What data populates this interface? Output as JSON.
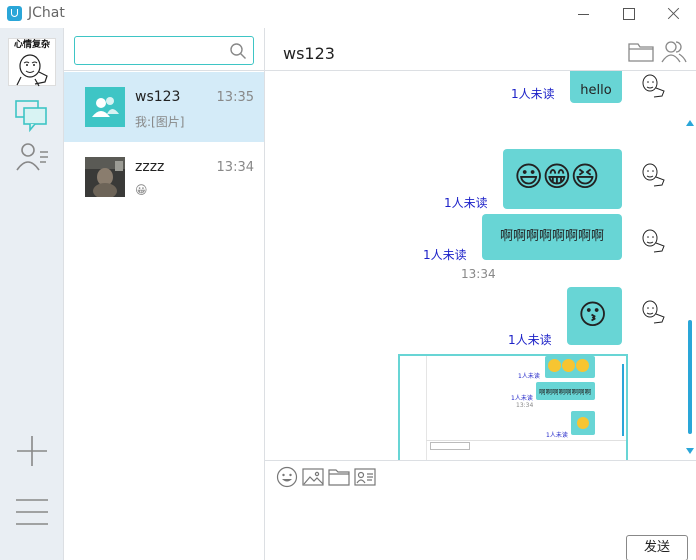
{
  "app": {
    "title": "JChat"
  },
  "user": {
    "avatar_caption": "心情复杂"
  },
  "search": {
    "placeholder": "",
    "value": ""
  },
  "conversations": [
    {
      "name": "ws123",
      "time": "13:35",
      "preview": "我:[图片]",
      "active": true
    },
    {
      "name": "zzzz",
      "time": "13:34",
      "preview": "😀",
      "active": false
    }
  ],
  "chat": {
    "name": "ws123",
    "timestamp": "13:34",
    "messages": [
      {
        "type": "text",
        "text": "hello",
        "status": "1人未读"
      },
      {
        "type": "emoji",
        "text": "😃😁😆",
        "status": "1人未读"
      },
      {
        "type": "text",
        "text": "啊啊啊啊啊啊啊啊",
        "status": "1人未读"
      },
      {
        "type": "emoji",
        "text": "😗",
        "status": "1人未读"
      },
      {
        "type": "image",
        "status": ""
      }
    ],
    "avatar_caption": "心情复杂"
  },
  "shot": {
    "unread_1": "1人未读",
    "unread_2": "1人未读",
    "unread_3": "1人未读",
    "text": "啊啊啊啊啊啊啊啊",
    "time": "13:34"
  },
  "composer": {
    "send_label": "发送"
  },
  "colors": {
    "accent": "#68d5d5",
    "unread": "#1d22c8",
    "active_row": "#d4ebf8",
    "scroll": "#2aa6d8"
  }
}
